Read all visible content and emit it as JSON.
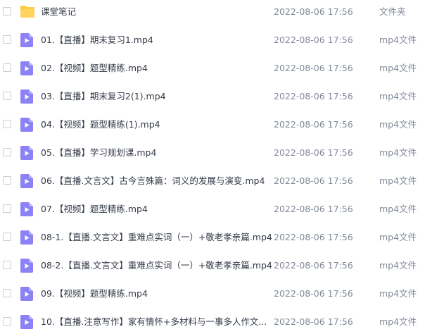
{
  "files": [
    {
      "name": "课堂笔记",
      "modified": "2022-08-06 17:56",
      "type": "文件夹",
      "icon": "folder-icon"
    },
    {
      "name": "01.【直播】期末复习1.mp4",
      "modified": "2022-08-06 17:56",
      "type": "mp4文件",
      "icon": "video-file-icon"
    },
    {
      "name": "02.【视频】题型精练.mp4",
      "modified": "2022-08-06 17:56",
      "type": "mp4文件",
      "icon": "video-file-icon"
    },
    {
      "name": "03.【直播】期末复习2(1).mp4",
      "modified": "2022-08-06 17:56",
      "type": "mp4文件",
      "icon": "video-file-icon"
    },
    {
      "name": "04.【视频】题型精练(1).mp4",
      "modified": "2022-08-06 17:56",
      "type": "mp4文件",
      "icon": "video-file-icon"
    },
    {
      "name": "05.【直播】学习规划课.mp4",
      "modified": "2022-08-06 17:56",
      "type": "mp4文件",
      "icon": "video-file-icon"
    },
    {
      "name": "06.【直播.文言文】古今言殊篇：词义的发展与演变.mp4",
      "modified": "2022-08-06 17:56",
      "type": "mp4文件",
      "icon": "video-file-icon"
    },
    {
      "name": "07.【视频】题型精练.mp4",
      "modified": "2022-08-06 17:56",
      "type": "mp4文件",
      "icon": "video-file-icon"
    },
    {
      "name": "08-1.【直播.文言文】重难点实词（一）+敬老孝亲篇.mp4",
      "modified": "2022-08-06 17:56",
      "type": "mp4文件",
      "icon": "video-file-icon"
    },
    {
      "name": "08-2.【直播.文言文】重难点实词（一）+敬老孝亲篇.mp4",
      "modified": "2022-08-06 17:56",
      "type": "mp4文件",
      "icon": "video-file-icon"
    },
    {
      "name": "09.【视频】题型精练.mp4",
      "modified": "2022-08-06 17:56",
      "type": "mp4文件",
      "icon": "video-file-icon"
    },
    {
      "name": "10.【直播.注意写作】家有情怀+多材料与一事多人作文...",
      "modified": "2022-08-06 17:56",
      "type": "mp4文件",
      "icon": "video-file-icon"
    }
  ],
  "colors": {
    "folder": "#ffc940",
    "video": "#8c82f5",
    "name_text": "#333a47",
    "meta_text": "#818999"
  }
}
